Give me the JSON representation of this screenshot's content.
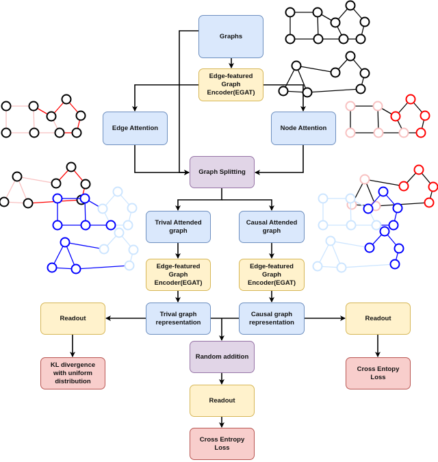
{
  "nodes": {
    "graphs": "Graphs",
    "egat_top": "Edge-featured Graph Encoder(EGAT)",
    "edge_attention": "Edge Attention",
    "node_attention": "Node Attention",
    "graph_splitting": "Graph Splitting",
    "trival_attended": "Trival Attended graph",
    "causal_attended": "Causal Attended graph",
    "egat_left": "Edge-featured Graph Encoder(EGAT)",
    "egat_right": "Edge-featured Graph Encoder(EGAT)",
    "trival_rep": "Trival graph representation",
    "causal_rep": "Causal graph representation",
    "readout_left": "Readout",
    "readout_right": "Readout",
    "random_addition": "Random addition",
    "kl_divergence": "KL divergence with uniform distribution",
    "cross_entopy_right": "Cross Entopy Loss",
    "readout_bottom": "Readout",
    "cross_entropy_bottom": "Cross Entropy Loss"
  },
  "colors": {
    "blue_fill": "#dae8fc",
    "yellow_fill": "#fff2cc",
    "purple_fill": "#e1d5e7",
    "red_fill": "#f8cecc",
    "graph_black": "#000000",
    "attention_red": "#ff0000",
    "attention_pink": "#f8c0c0",
    "trivial_blue": "#0000ff",
    "faded_blue": "#cce5ff"
  }
}
